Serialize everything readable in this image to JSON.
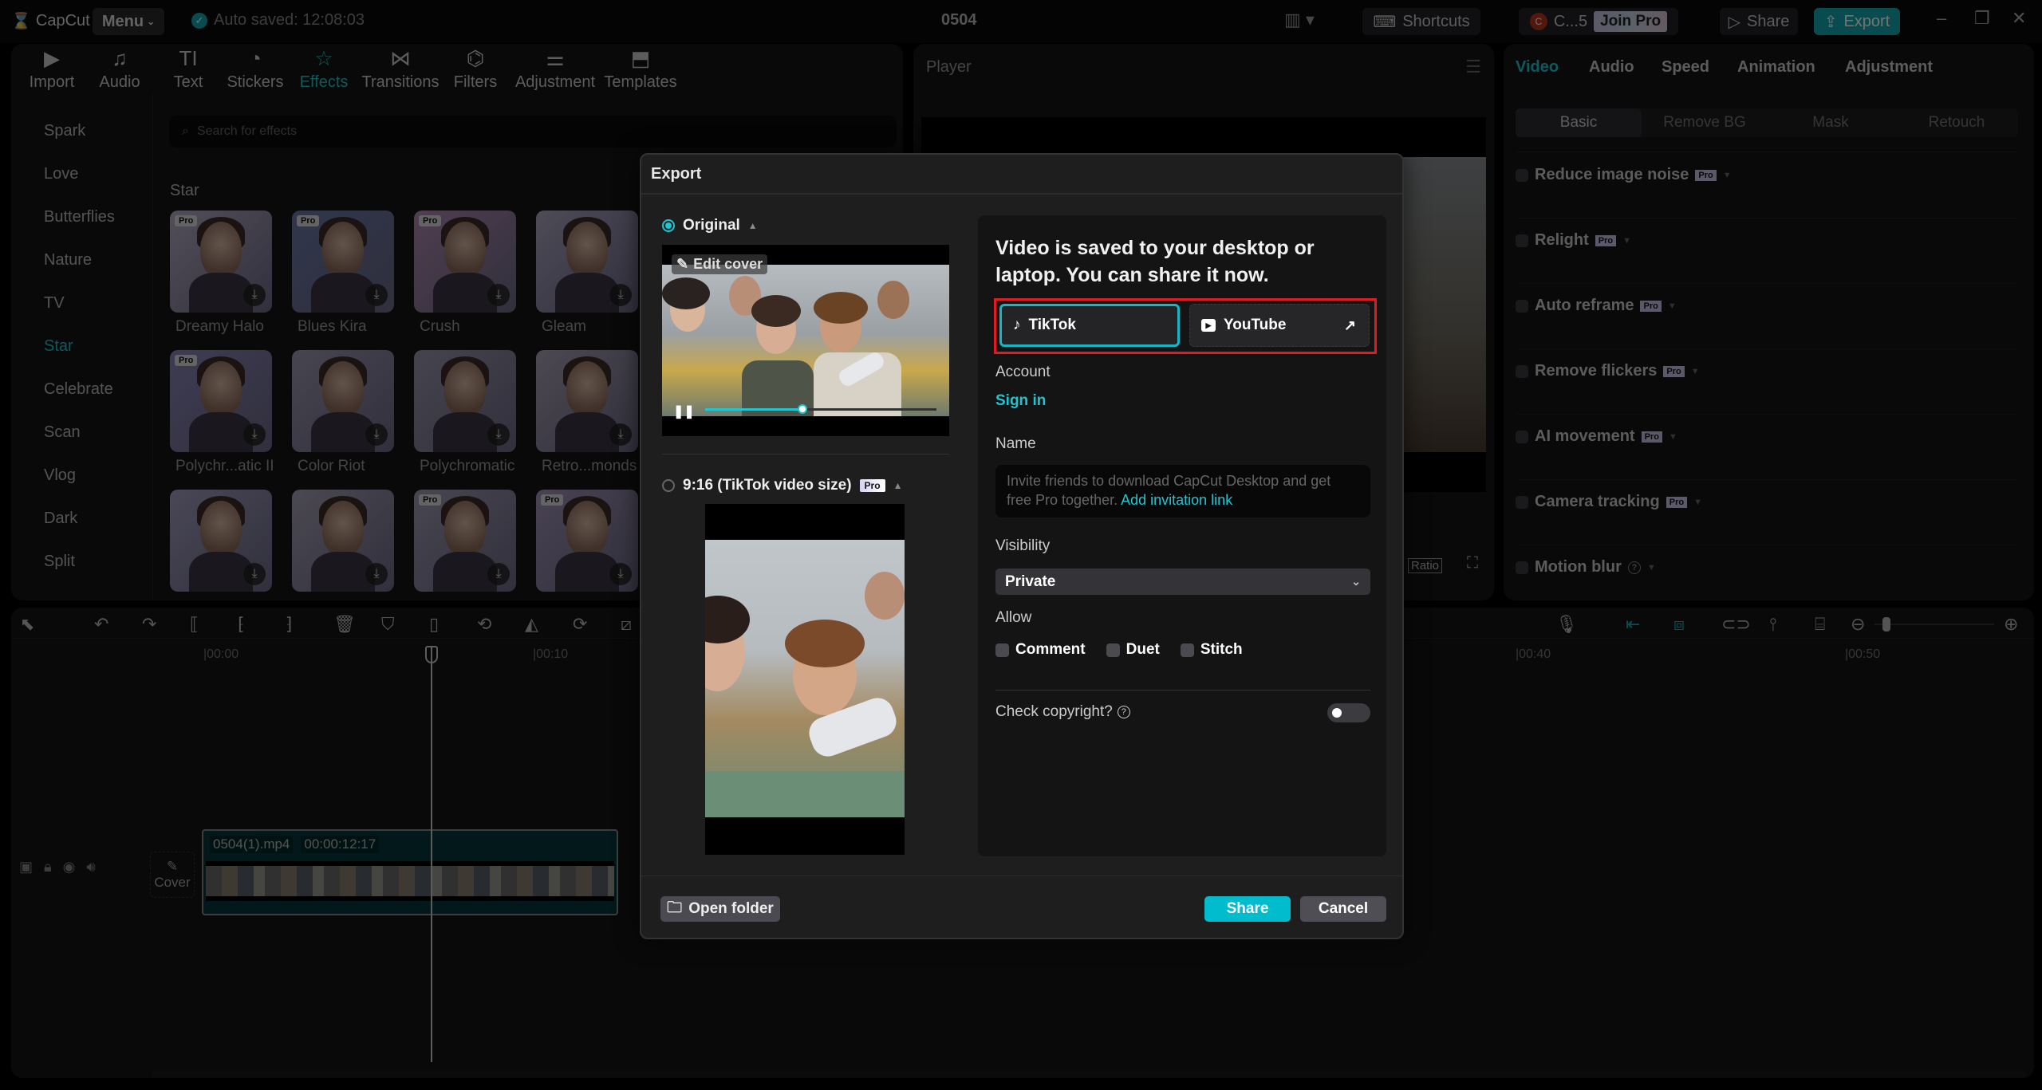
{
  "topbar": {
    "logo": "CapCut",
    "menu_label": "Menu",
    "autosave": "Auto saved: 12:08:03",
    "project_title": "0504",
    "shortcuts_label": "Shortcuts",
    "user_label": "C...5",
    "join_pro_label": "Join Pro",
    "share_label": "Share",
    "export_label": "Export"
  },
  "toolbar": {
    "tabs": [
      {
        "label": "Import",
        "icon": "import-icon"
      },
      {
        "label": "Audio",
        "icon": "audio-icon"
      },
      {
        "label": "Text",
        "icon": "text-icon"
      },
      {
        "label": "Stickers",
        "icon": "stickers-icon"
      },
      {
        "label": "Effects",
        "icon": "effects-icon",
        "active": true
      },
      {
        "label": "Transitions",
        "icon": "transitions-icon"
      },
      {
        "label": "Filters",
        "icon": "filters-icon"
      },
      {
        "label": "Adjustment",
        "icon": "adjustment-icon"
      },
      {
        "label": "Templates",
        "icon": "templates-icon"
      }
    ]
  },
  "effects": {
    "categories": [
      "Spark",
      "Love",
      "Butterflies",
      "Nature",
      "TV",
      "Star",
      "Celebrate",
      "Scan",
      "Vlog",
      "Dark",
      "Split"
    ],
    "active_category": "Star",
    "search_placeholder": "Search for effects",
    "section_title": "Star",
    "items": [
      {
        "name": "Dreamy Halo",
        "pro": true
      },
      {
        "name": "Blues Kira",
        "pro": true
      },
      {
        "name": "Crush",
        "pro": true
      },
      {
        "name": "Gleam",
        "pro": false
      },
      {
        "name": "Polychr...atic II",
        "pro": true
      },
      {
        "name": "Color Riot",
        "pro": false
      },
      {
        "name": "Polychromatic",
        "pro": false
      },
      {
        "name": "Retro...monds",
        "pro": false
      },
      {
        "name": "",
        "pro": false
      },
      {
        "name": "",
        "pro": false
      },
      {
        "name": "",
        "pro": true
      },
      {
        "name": "",
        "pro": true
      }
    ],
    "pro_badge": "Pro"
  },
  "player": {
    "title": "Player",
    "ratio_label": "Ratio"
  },
  "inspector": {
    "tabs": [
      "Video",
      "Audio",
      "Speed",
      "Animation",
      "Adjustment"
    ],
    "active_tab": "Video",
    "subtabs": [
      "Basic",
      "Remove BG",
      "Mask",
      "Retouch"
    ],
    "active_subtab": "Basic",
    "properties": [
      {
        "label": "Reduce image noise",
        "pro": true
      },
      {
        "label": "Relight",
        "pro": true
      },
      {
        "label": "Auto reframe",
        "pro": true
      },
      {
        "label": "Remove flickers",
        "pro": true
      },
      {
        "label": "AI movement",
        "pro": true
      },
      {
        "label": "Camera tracking",
        "pro": true
      },
      {
        "label": "Motion blur",
        "pro": false,
        "help": true
      }
    ]
  },
  "timeline": {
    "ticks": [
      "00:00",
      "00:10",
      "00:40",
      "00:50"
    ],
    "cover_label": "Cover",
    "clip": {
      "name": "0504(1).mp4",
      "duration": "00:00:12:17"
    }
  },
  "export_dialog": {
    "title": "Export",
    "options": [
      {
        "label": "Original",
        "selected": true,
        "pro": false
      },
      {
        "label": "9:16 (TikTok video size)",
        "selected": false,
        "pro": true
      }
    ],
    "edit_cover_label": "Edit cover",
    "preview_progress": 0.42,
    "share_title": "Video is saved to your desktop or laptop. You can share it now.",
    "platforms": [
      {
        "label": "TikTok",
        "selected": true
      },
      {
        "label": "YouTube",
        "selected": false,
        "external": true
      }
    ],
    "account_label": "Account",
    "sign_in_label": "Sign in",
    "name_label": "Name",
    "name_placeholder": "Invite friends to download CapCut Desktop and get free Pro together.",
    "invite_link_label": "Add invitation link",
    "visibility_label": "Visibility",
    "visibility_value": "Private",
    "allow_label": "Allow",
    "allow_options": [
      "Comment",
      "Duet",
      "Stitch"
    ],
    "copyright_label": "Check copyright?",
    "copyright_enabled": false,
    "open_folder_label": "Open folder",
    "share_label": "Share",
    "cancel_label": "Cancel",
    "colors": {
      "accent": "#00bccc",
      "highlight": "#e01b24"
    }
  }
}
